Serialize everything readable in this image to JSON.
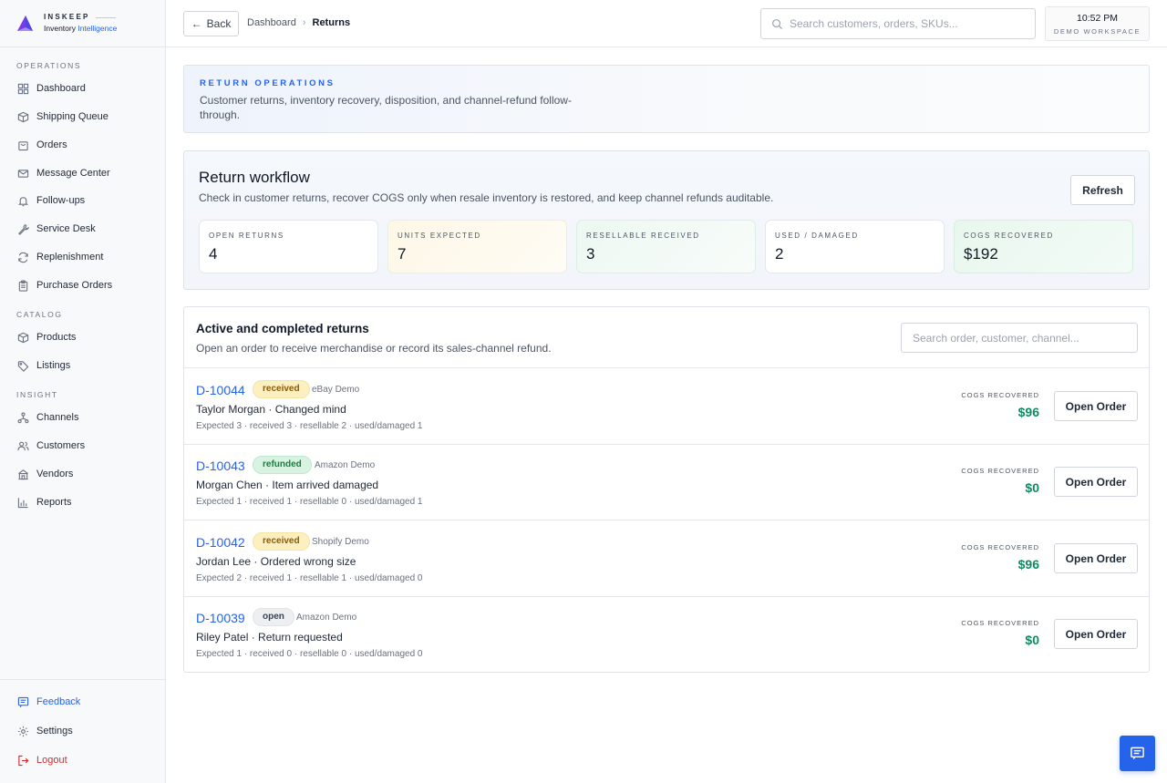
{
  "brand": {
    "name": "INSKEEP",
    "sub_prefix": "Inventory ",
    "sub_highlight": "Intelligence"
  },
  "sidebar": {
    "sections": [
      {
        "label": "OPERATIONS"
      },
      {
        "label": "CATALOG"
      },
      {
        "label": "INSIGHT"
      }
    ],
    "items": [
      {
        "label": "Dashboard",
        "icon": "grid-icon"
      },
      {
        "label": "Shipping Queue",
        "icon": "box-icon"
      },
      {
        "label": "Orders",
        "icon": "bag-icon"
      },
      {
        "label": "Message Center",
        "icon": "mail-icon"
      },
      {
        "label": "Follow-ups",
        "icon": "bell-icon"
      },
      {
        "label": "Service Desk",
        "icon": "wrench-icon"
      },
      {
        "label": "Replenishment",
        "icon": "refresh-icon"
      },
      {
        "label": "Purchase Orders",
        "icon": "clipboard-icon"
      },
      {
        "label": "Products",
        "icon": "box-icon"
      },
      {
        "label": "Listings",
        "icon": "tag-icon"
      },
      {
        "label": "Channels",
        "icon": "network-icon"
      },
      {
        "label": "Customers",
        "icon": "users-icon"
      },
      {
        "label": "Vendors",
        "icon": "building-icon"
      },
      {
        "label": "Reports",
        "icon": "bar-chart-icon"
      }
    ],
    "footer": {
      "feedback": "Feedback",
      "settings": "Settings",
      "logout": "Logout"
    }
  },
  "topbar": {
    "back": "Back",
    "breadcrumb": {
      "parent": "Dashboard",
      "separator": "›",
      "current": "Returns"
    },
    "search_placeholder": "Search customers, orders, SKUs...",
    "clock": {
      "time": "10:52 PM",
      "workspace": "DEMO WORKSPACE"
    }
  },
  "banner": {
    "eyebrow": "RETURN OPERATIONS",
    "description": "Customer returns, inventory recovery, disposition, and channel-refund follow-through."
  },
  "workflow": {
    "title": "Return workflow",
    "subtitle": "Check in customer returns, recover COGS only when resale inventory is restored, and keep channel refunds auditable.",
    "refresh": "Refresh",
    "stats": [
      {
        "label": "OPEN RETURNS",
        "value": "4",
        "tone": "plain"
      },
      {
        "label": "UNITS EXPECTED",
        "value": "7",
        "tone": "amber"
      },
      {
        "label": "RESELLABLE RECEIVED",
        "value": "3",
        "tone": "green"
      },
      {
        "label": "USED / DAMAGED",
        "value": "2",
        "tone": "plain"
      },
      {
        "label": "COGS RECOVERED",
        "value": "$192",
        "tone": "green2"
      }
    ]
  },
  "returns": {
    "title": "Active and completed returns",
    "subtitle": "Open an order to receive merchandise or record its sales-channel refund.",
    "search_placeholder": "Search order, customer, channel...",
    "cogs_label": "COGS RECOVERED",
    "open_label": "Open Order",
    "rows": [
      {
        "id": "D-10044",
        "status": "received",
        "channel": "eBay Demo",
        "who": "Taylor Morgan · Changed mind",
        "counts": "Expected 3 · received 3 · resellable 2 · used/damaged 1",
        "cogs": "$96"
      },
      {
        "id": "D-10043",
        "status": "refunded",
        "channel": "Amazon Demo",
        "who": "Morgan Chen · Item arrived damaged",
        "counts": "Expected 1 · received 1 · resellable 0 · used/damaged 1",
        "cogs": "$0"
      },
      {
        "id": "D-10042",
        "status": "received",
        "channel": "Shopify Demo",
        "who": "Jordan Lee · Ordered wrong size",
        "counts": "Expected 2 · received 1 · resellable 1 · used/damaged 0",
        "cogs": "$96"
      },
      {
        "id": "D-10039",
        "status": "open",
        "channel": "Amazon Demo",
        "who": "Riley Patel · Return requested",
        "counts": "Expected 1 · received 0 · resellable 0 · used/damaged 0",
        "cogs": "$0"
      }
    ]
  },
  "colors": {
    "accent": "#2563eb",
    "money": "#0f8a5f",
    "logout": "#dc2626"
  }
}
